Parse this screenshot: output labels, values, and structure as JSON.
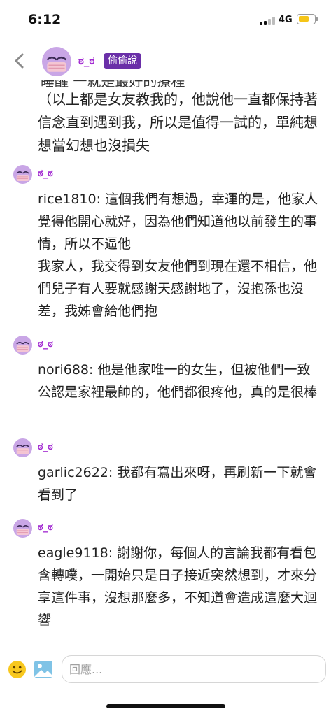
{
  "status_bar": {
    "time": "6:12",
    "network": "4G"
  },
  "header": {
    "name": "ಠ_ಠ",
    "badge": "偷偷說",
    "partial_line": "睡醒 一就是最好的療程"
  },
  "top_text": "（以上都是女友教我的，他說他一直都保持著信念直到遇到我，所以是值得一試的，單純想想當幻想也沒損失",
  "messages": [
    {
      "name": "ಠ_ಠ",
      "paragraphs": [
        "rice1810: 這個我們有想過，幸運的是，他家人覺得他開心就好，因為他們知道他以前發生的事情，所以不逼他",
        "我家人，我交得到女友他們到現在還不相信，他們兒子有人要就感謝天感謝地了，沒抱孫也沒差，我姊會給他們抱"
      ]
    },
    {
      "name": "ಠ_ಠ",
      "paragraphs": [
        "nori688: 他是他家唯一的女生，但被他們一致公認是家裡最帥的，他們都很疼他，真的是很棒"
      ]
    },
    {
      "name": "ಠ_ಠ",
      "paragraphs": [
        "garlic2622: 我都有寫出來呀，再刷新一下就會看到了"
      ]
    },
    {
      "name": "ಠ_ಠ",
      "paragraphs": [
        "eagle9118: 謝謝你，每個人的言論我都有看包含轉噗，一開始只是日子接近突然想到，才來分享這件事，沒想那麼多，不知道會造成這麼大迴響"
      ]
    }
  ],
  "input_bar": {
    "placeholder": "回應..."
  },
  "icons": {
    "back": "chevron-left-icon",
    "avatar": "masked-face-avatar",
    "emoji": "smiley-icon",
    "image": "image-icon"
  },
  "colors": {
    "name": "#a22ad1",
    "badge_bg": "#6a2fa8",
    "avatar_bg": "#c9a6e6",
    "mask": "#f4c6d3"
  }
}
